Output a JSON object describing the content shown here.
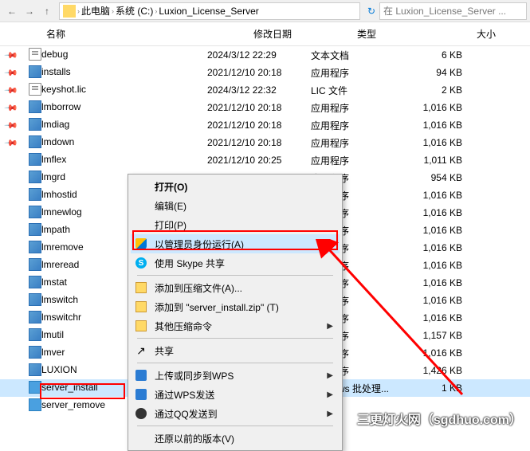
{
  "breadcrumb": {
    "root": "此电脑",
    "drive": "系统 (C:)",
    "folder": "Luxion_License_Server"
  },
  "search": {
    "placeholder": "在 Luxion_License_Server ..."
  },
  "headers": {
    "name": "名称",
    "date": "修改日期",
    "type": "类型",
    "size": "大小"
  },
  "files": [
    {
      "name": "debug",
      "date": "2024/3/12 22:29",
      "type": "文本文档",
      "size": "6 KB",
      "icon": "doc",
      "pinned": true
    },
    {
      "name": "installs",
      "date": "2021/12/10 20:18",
      "type": "应用程序",
      "size": "94 KB",
      "icon": "exe",
      "pinned": true
    },
    {
      "name": "keyshot.lic",
      "date": "2024/3/12 22:32",
      "type": "LIC 文件",
      "size": "2 KB",
      "icon": "doc",
      "pinned": true
    },
    {
      "name": "lmborrow",
      "date": "2021/12/10 20:18",
      "type": "应用程序",
      "size": "1,016 KB",
      "icon": "exe",
      "pinned": true
    },
    {
      "name": "lmdiag",
      "date": "2021/12/10 20:18",
      "type": "应用程序",
      "size": "1,016 KB",
      "icon": "exe",
      "pinned": true
    },
    {
      "name": "lmdown",
      "date": "2021/12/10 20:18",
      "type": "应用程序",
      "size": "1,016 KB",
      "icon": "exe",
      "pinned": true
    },
    {
      "name": "lmflex",
      "date": "2021/12/10 20:25",
      "type": "应用程序",
      "size": "1,011 KB",
      "icon": "exe"
    },
    {
      "name": "lmgrd",
      "date": "",
      "type": "应用程序",
      "size": "954 KB",
      "icon": "exe"
    },
    {
      "name": "lmhostid",
      "date": "",
      "type": "应用程序",
      "size": "1,016 KB",
      "icon": "exe"
    },
    {
      "name": "lmnewlog",
      "date": "",
      "type": "应用程序",
      "size": "1,016 KB",
      "icon": "exe"
    },
    {
      "name": "lmpath",
      "date": "",
      "type": "应用程序",
      "size": "1,016 KB",
      "icon": "exe"
    },
    {
      "name": "lmremove",
      "date": "",
      "type": "应用程序",
      "size": "1,016 KB",
      "icon": "exe"
    },
    {
      "name": "lmreread",
      "date": "",
      "type": "应用程序",
      "size": "1,016 KB",
      "icon": "exe"
    },
    {
      "name": "lmstat",
      "date": "",
      "type": "应用程序",
      "size": "1,016 KB",
      "icon": "exe"
    },
    {
      "name": "lmswitch",
      "date": "",
      "type": "应用程序",
      "size": "1,016 KB",
      "icon": "exe"
    },
    {
      "name": "lmswitchr",
      "date": "",
      "type": "应用程序",
      "size": "1,016 KB",
      "icon": "exe"
    },
    {
      "name": "lmutil",
      "date": "",
      "type": "应用程序",
      "size": "1,157 KB",
      "icon": "exe"
    },
    {
      "name": "lmver",
      "date": "",
      "type": "应用程序",
      "size": "1,016 KB",
      "icon": "exe"
    },
    {
      "name": "LUXION",
      "date": "",
      "type": "应用程序",
      "size": "1,426 KB",
      "icon": "exe"
    },
    {
      "name": "server_install",
      "date": "",
      "type": "Windows 批处理...",
      "size": "1 KB",
      "icon": "blue",
      "selected": true,
      "highlighted": true
    },
    {
      "name": "server_remove",
      "date": "",
      "type": "",
      "size": "",
      "icon": "blue"
    }
  ],
  "menu": {
    "open": "打开(O)",
    "edit": "编辑(E)",
    "print": "打印(P)",
    "runas": "以管理员身份运行(A)",
    "skype": "使用 Skype 共享",
    "addzip": "添加到压缩文件(A)...",
    "addzip2": "添加到 \"server_install.zip\" (T)",
    "otherzip": "其他压缩命令",
    "share": "共享",
    "uploadwps": "上传或同步到WPS",
    "sendwps": "通过WPS发送",
    "sendqq": "通过QQ发送到",
    "restore": "还原以前的版本(V)"
  },
  "watermark": "三更灯火网（sgdhuo.com）"
}
